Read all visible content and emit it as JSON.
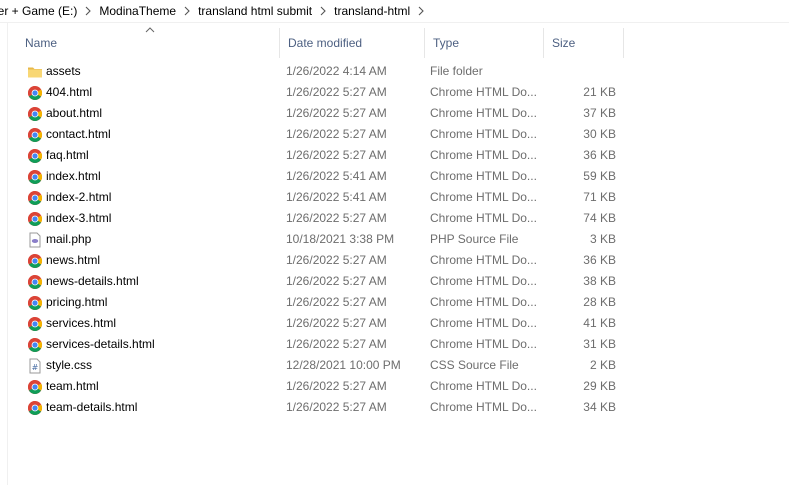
{
  "breadcrumb": [
    "wer + Game (E:)",
    "ModinaTheme",
    "transland html submit",
    "transland-html"
  ],
  "columns": {
    "name": "Name",
    "date": "Date modified",
    "type": "Type",
    "size": "Size"
  },
  "files": [
    {
      "name": "assets",
      "date": "1/26/2022 4:14 AM",
      "type": "File folder",
      "size": "",
      "icon": "folder-icon"
    },
    {
      "name": "404.html",
      "date": "1/26/2022 5:27 AM",
      "type": "Chrome HTML Do...",
      "size": "21 KB",
      "icon": "chrome-icon"
    },
    {
      "name": "about.html",
      "date": "1/26/2022 5:27 AM",
      "type": "Chrome HTML Do...",
      "size": "37 KB",
      "icon": "chrome-icon"
    },
    {
      "name": "contact.html",
      "date": "1/26/2022 5:27 AM",
      "type": "Chrome HTML Do...",
      "size": "30 KB",
      "icon": "chrome-icon"
    },
    {
      "name": "faq.html",
      "date": "1/26/2022 5:27 AM",
      "type": "Chrome HTML Do...",
      "size": "36 KB",
      "icon": "chrome-icon"
    },
    {
      "name": "index.html",
      "date": "1/26/2022 5:41 AM",
      "type": "Chrome HTML Do...",
      "size": "59 KB",
      "icon": "chrome-icon"
    },
    {
      "name": "index-2.html",
      "date": "1/26/2022 5:41 AM",
      "type": "Chrome HTML Do...",
      "size": "71 KB",
      "icon": "chrome-icon"
    },
    {
      "name": "index-3.html",
      "date": "1/26/2022 5:27 AM",
      "type": "Chrome HTML Do...",
      "size": "74 KB",
      "icon": "chrome-icon"
    },
    {
      "name": "mail.php",
      "date": "10/18/2021 3:38 PM",
      "type": "PHP Source File",
      "size": "3 KB",
      "icon": "php-file-icon"
    },
    {
      "name": "news.html",
      "date": "1/26/2022 5:27 AM",
      "type": "Chrome HTML Do...",
      "size": "36 KB",
      "icon": "chrome-icon"
    },
    {
      "name": "news-details.html",
      "date": "1/26/2022 5:27 AM",
      "type": "Chrome HTML Do...",
      "size": "38 KB",
      "icon": "chrome-icon"
    },
    {
      "name": "pricing.html",
      "date": "1/26/2022 5:27 AM",
      "type": "Chrome HTML Do...",
      "size": "28 KB",
      "icon": "chrome-icon"
    },
    {
      "name": "services.html",
      "date": "1/26/2022 5:27 AM",
      "type": "Chrome HTML Do...",
      "size": "41 KB",
      "icon": "chrome-icon"
    },
    {
      "name": "services-details.html",
      "date": "1/26/2022 5:27 AM",
      "type": "Chrome HTML Do...",
      "size": "31 KB",
      "icon": "chrome-icon"
    },
    {
      "name": "style.css",
      "date": "12/28/2021 10:00 PM",
      "type": "CSS Source File",
      "size": "2 KB",
      "icon": "css-file-icon"
    },
    {
      "name": "team.html",
      "date": "1/26/2022 5:27 AM",
      "type": "Chrome HTML Do...",
      "size": "29 KB",
      "icon": "chrome-icon"
    },
    {
      "name": "team-details.html",
      "date": "1/26/2022 5:27 AM",
      "type": "Chrome HTML Do...",
      "size": "34 KB",
      "icon": "chrome-icon"
    }
  ],
  "colors": {
    "header_text": "#4d6082",
    "muted_text": "#6d6d6d",
    "folder": "#f8d775"
  }
}
